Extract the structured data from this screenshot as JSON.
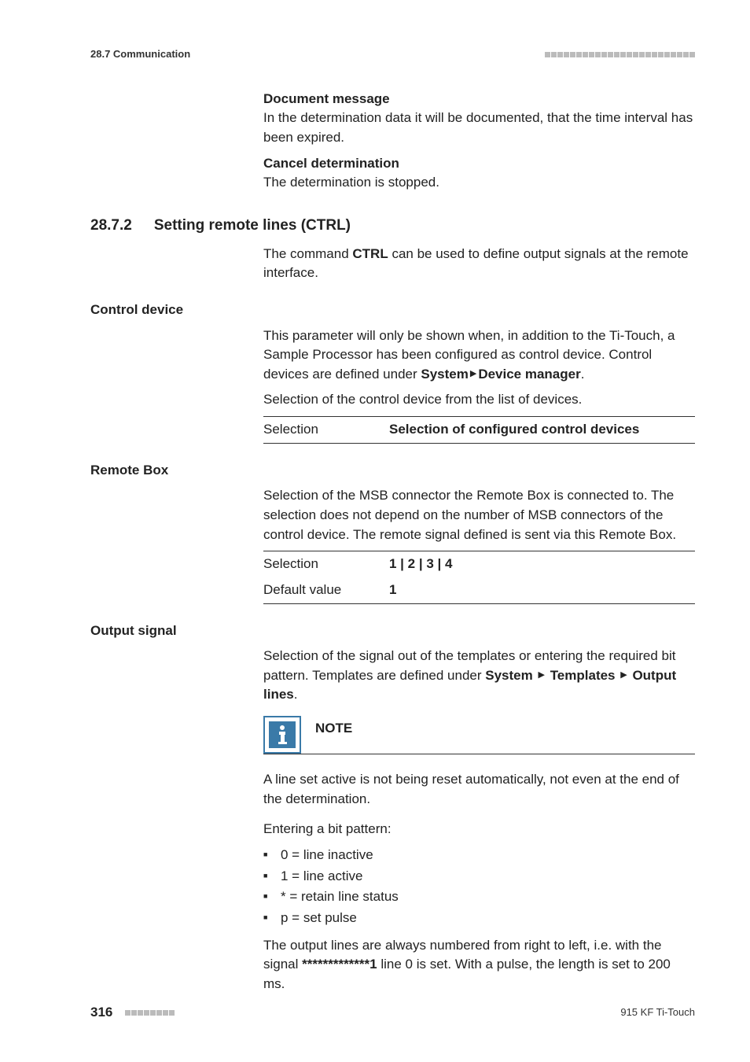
{
  "header": {
    "section": "28.7 Communication"
  },
  "docmsg": {
    "title": "Document message",
    "text": "In the determination data it will be documented, that the time interval has been expired."
  },
  "cancel": {
    "title": "Cancel determination",
    "text": "The determination is stopped."
  },
  "section": {
    "number": "28.7.2",
    "title": "Setting remote lines (CTRL)",
    "intro_pre": "The command ",
    "intro_bold": "CTRL",
    "intro_post": " can be used to define output signals at the remote interface."
  },
  "controlDevice": {
    "label": "Control device",
    "p1_pre": "This parameter will only be shown when, in addition to the Ti-Touch, a Sample Processor has been configured as control device. Control devices are defined under ",
    "p1_b1": "System",
    "p1_b2": "Device manager",
    "p1_post": ".",
    "p2": "Selection of the control device from the list of devices.",
    "table": {
      "keySel": "Selection",
      "valSel": "Selection of configured control devices"
    }
  },
  "remoteBox": {
    "label": "Remote Box",
    "p1": "Selection of the MSB connector the Remote Box is connected to. The selection does not depend on the number of MSB connectors of the control device. The remote signal defined is sent via this Remote Box.",
    "table": {
      "keySel": "Selection",
      "valSel": "1 | 2 | 3 | 4",
      "keyDef": "Default value",
      "valDef": "1"
    }
  },
  "outputSignal": {
    "label": "Output signal",
    "p1_pre": "Selection of the signal out of the templates or entering the required bit pattern. Templates are defined under ",
    "p1_b1": "System",
    "p1_b2": "Templates",
    "p1_b3": "Output lines",
    "p1_post": ".",
    "note": {
      "title": "NOTE",
      "body": "A line set active is not being reset automatically, not even at the end of the determination."
    },
    "bitIntro": "Entering a bit pattern:",
    "bits": {
      "b0": "0 = line inactive",
      "b1": "1 = line active",
      "b2": "* = retain line status",
      "b3": "p = set pulse"
    },
    "p2_pre": "The output lines are always numbered from right to left, i.e. with the signal ",
    "p2_bold": "*************1",
    "p2_post": " line 0 is set. With a pulse, the length is set to 200 ms."
  },
  "footer": {
    "page": "316",
    "product": "915 KF Ti-Touch"
  }
}
